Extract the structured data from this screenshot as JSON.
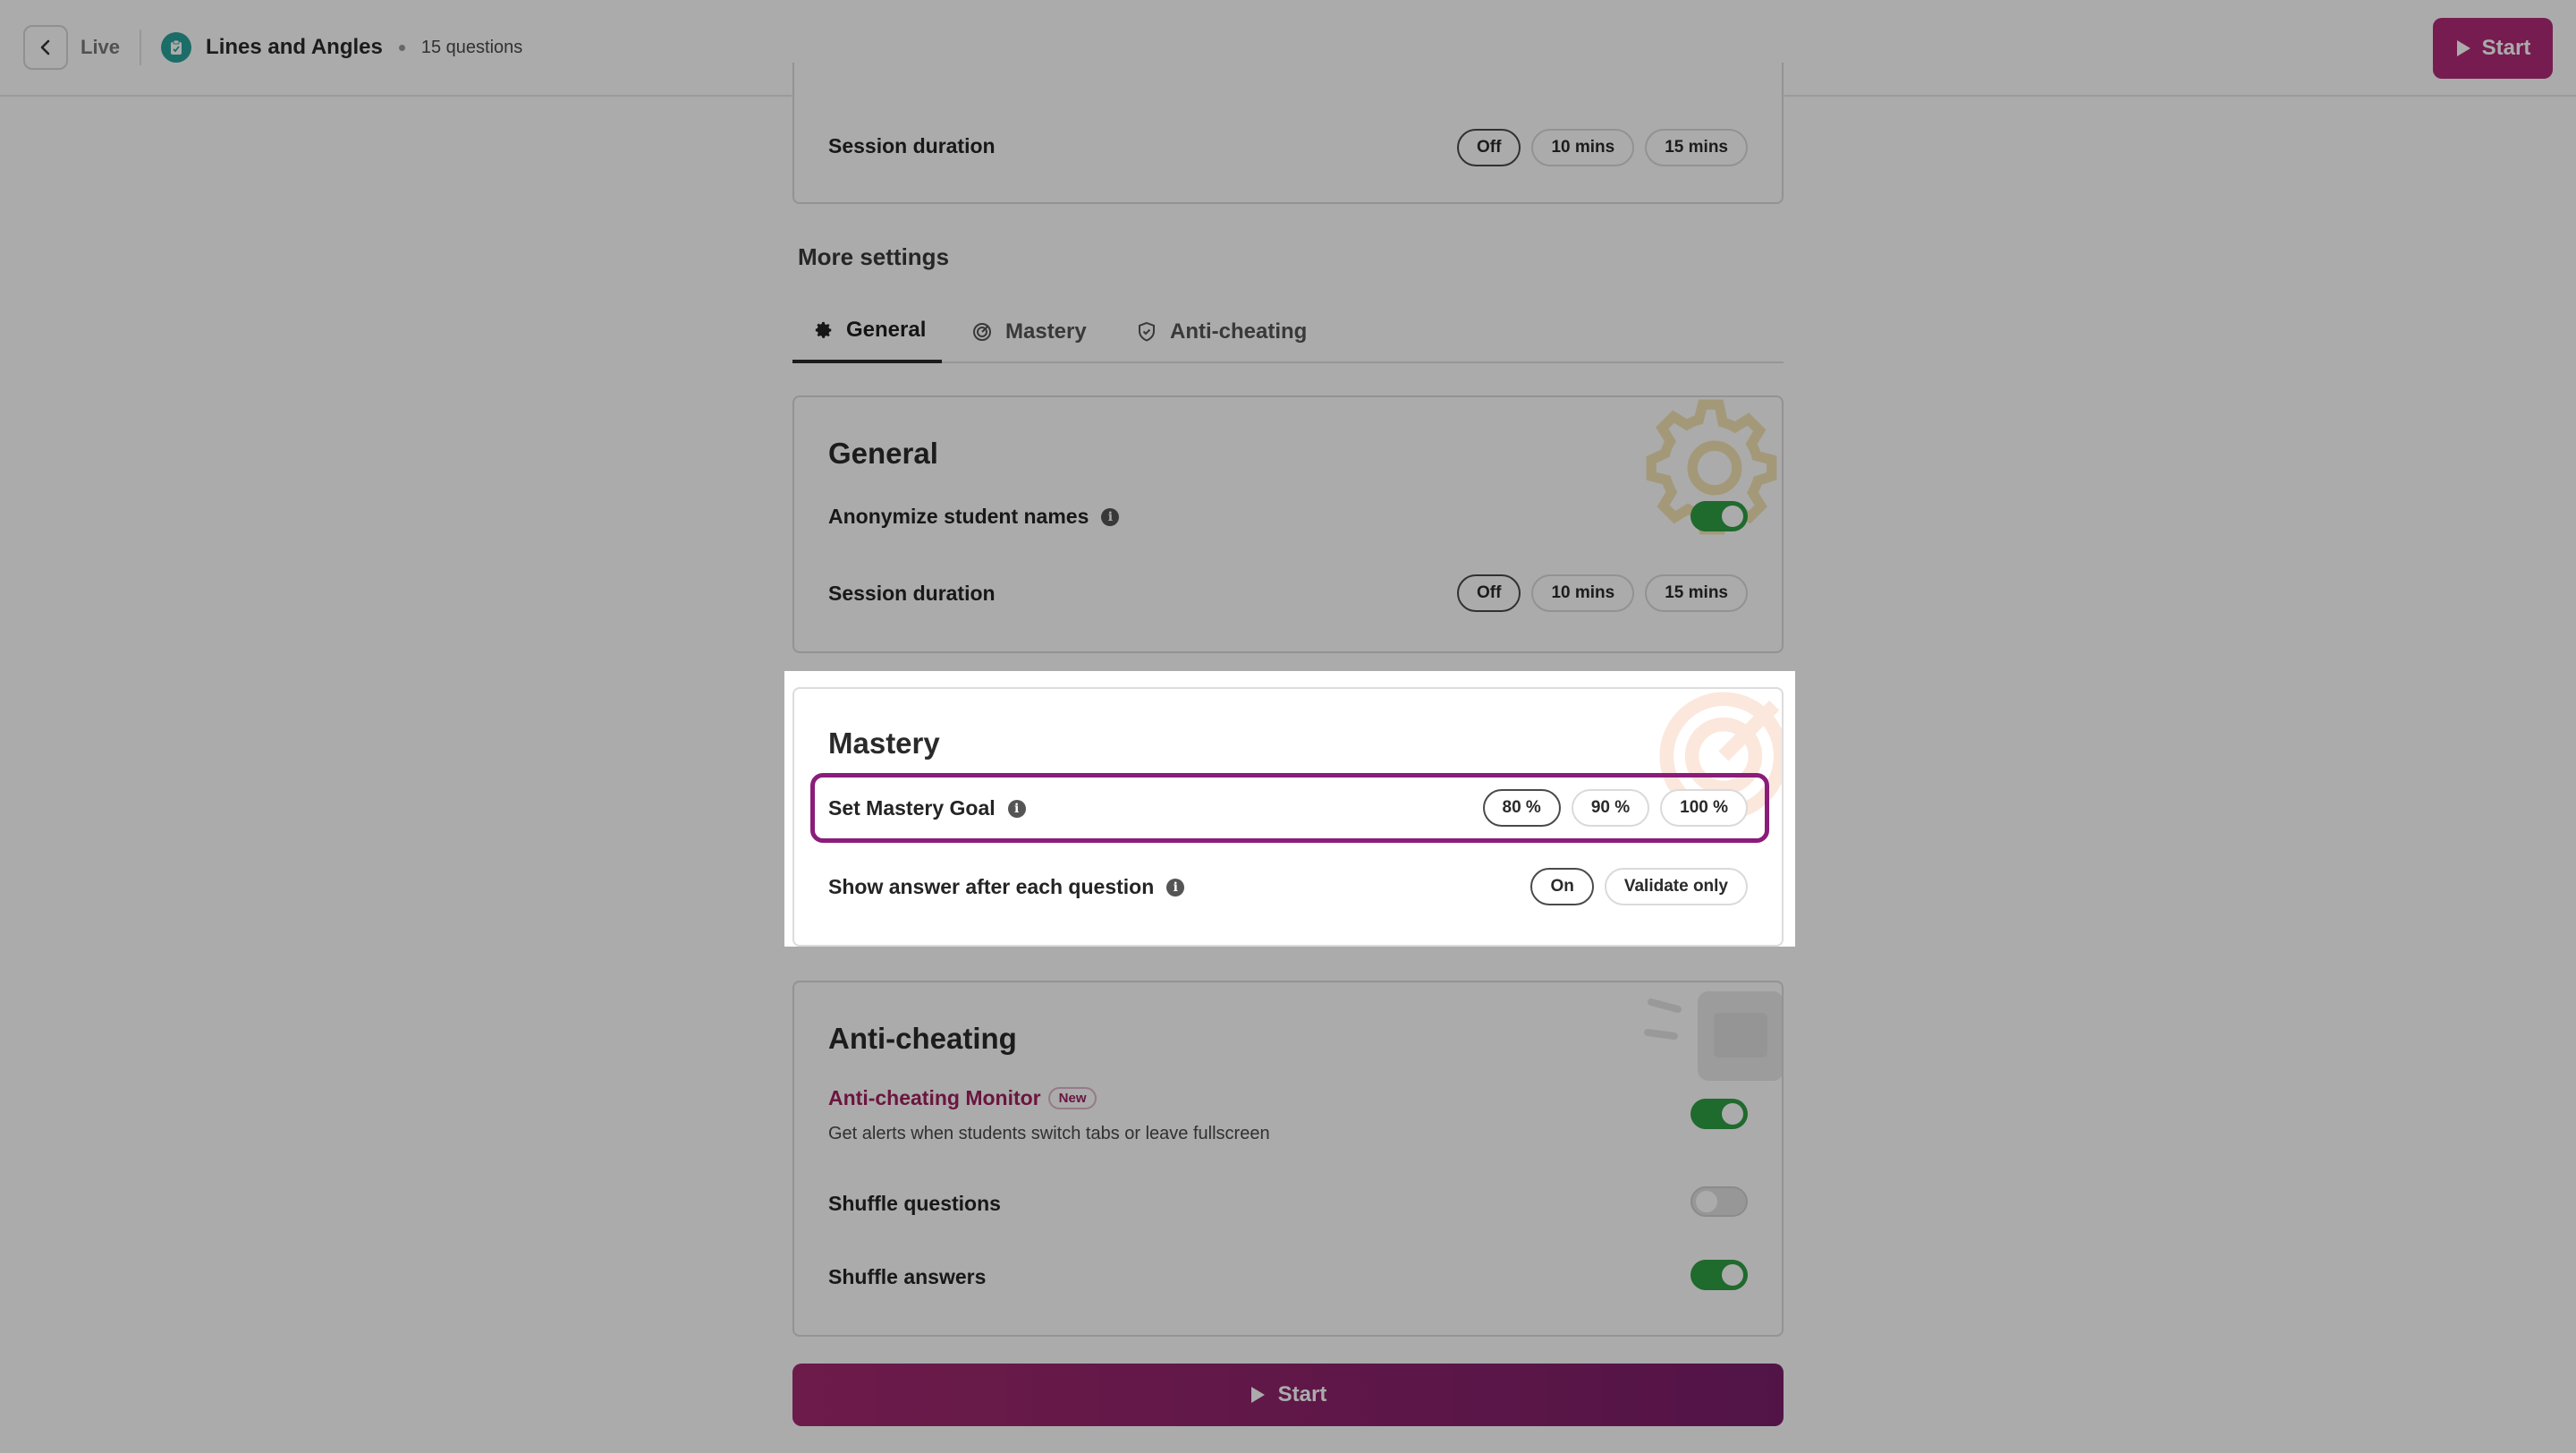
{
  "header": {
    "live_label": "Live",
    "quiz_title": "Lines and Angles",
    "question_count": "15 questions",
    "start_label": "Start"
  },
  "top_session": {
    "label": "Session duration",
    "options": [
      "Off",
      "10 mins",
      "15 mins"
    ],
    "selected": "Off"
  },
  "more_settings": {
    "heading": "More settings",
    "tabs": [
      {
        "label": "General",
        "icon": "gear-icon",
        "active": true
      },
      {
        "label": "Mastery",
        "icon": "target-icon",
        "active": false
      },
      {
        "label": "Anti-cheating",
        "icon": "shield-icon",
        "active": false
      }
    ]
  },
  "general": {
    "title": "General",
    "anonymize_label": "Anonymize student names",
    "anonymize_on": true,
    "session_label": "Session duration",
    "session_options": [
      "Off",
      "10 mins",
      "15 mins"
    ],
    "session_selected": "Off"
  },
  "mastery": {
    "title": "Mastery",
    "goal_label": "Set Mastery Goal",
    "goal_options": [
      "80 %",
      "90 %",
      "100 %"
    ],
    "goal_selected": "80 %",
    "answer_label": "Show answer after each question",
    "answer_options": [
      "On",
      "Validate only"
    ],
    "answer_selected": "On"
  },
  "anti_cheating": {
    "title": "Anti-cheating",
    "monitor_label": "Anti-cheating Monitor",
    "monitor_badge": "New",
    "monitor_desc": "Get alerts when students switch tabs or leave fullscreen",
    "monitor_on": true,
    "shuffle_questions_label": "Shuffle questions",
    "shuffle_questions_on": false,
    "shuffle_answers_label": "Shuffle answers",
    "shuffle_answers_on": true
  },
  "bottom": {
    "start_label": "Start"
  },
  "colors": {
    "brand": "#a3296f",
    "toggle_on": "#2f9e44",
    "highlight": "#8a1d7a"
  }
}
